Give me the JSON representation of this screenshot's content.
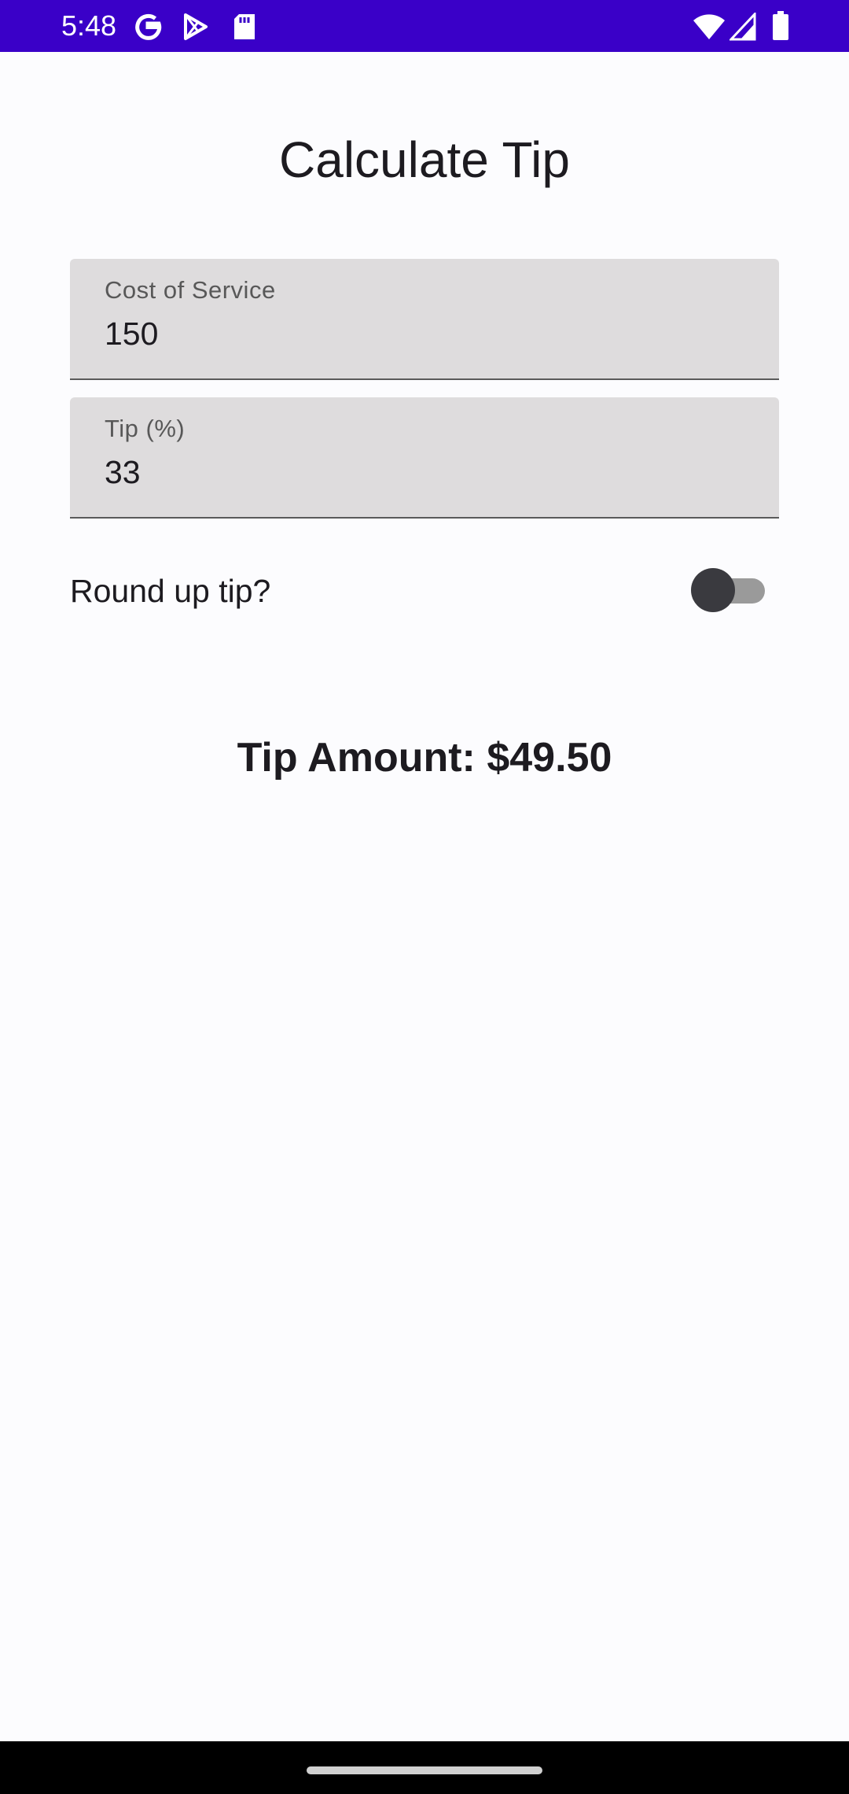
{
  "status_bar": {
    "time": "5:48",
    "left_icons": [
      "google-icon",
      "play-store-icon",
      "sd-card-icon"
    ],
    "right_icons": [
      "wifi-icon",
      "cell-signal-icon",
      "battery-icon"
    ],
    "background_color": "#3a00c8"
  },
  "header": {
    "title": "Calculate Tip"
  },
  "form": {
    "cost_field": {
      "label": "Cost of Service",
      "value": "150"
    },
    "tip_field": {
      "label": "Tip (%)",
      "value": "33"
    },
    "round_up": {
      "label": "Round up tip?",
      "checked": false
    }
  },
  "result": {
    "text": "Tip Amount: $49.50"
  }
}
